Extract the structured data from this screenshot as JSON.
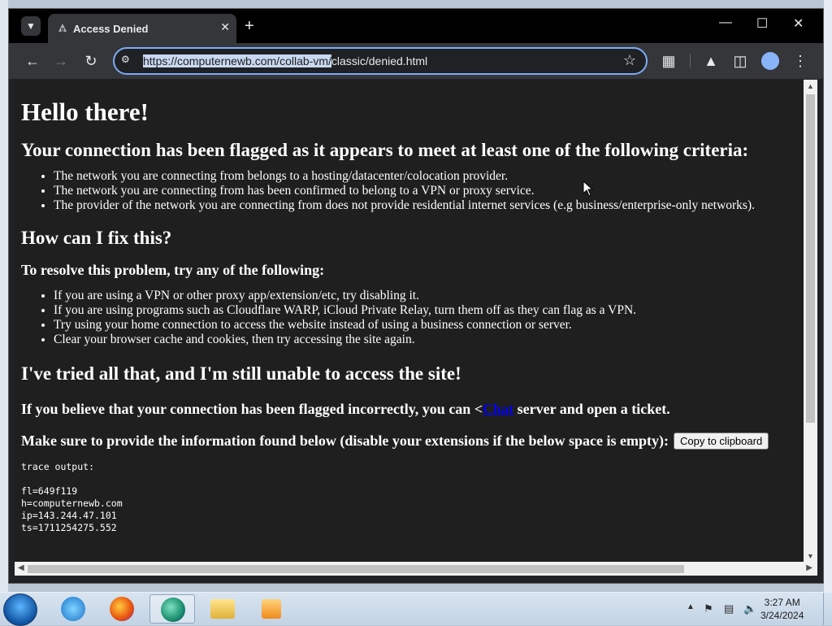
{
  "browser": {
    "tab_title": "Access Denied",
    "url_selected": "https://computernewb.com/collab-vm/",
    "url_rest": "classic/denied.html"
  },
  "page": {
    "h1": "Hello there!",
    "criteria_heading": "Your connection has been flagged as it appears to meet at least one of the following criteria:",
    "criteria": [
      "The network you are connecting from belongs to a hosting/datacenter/colocation provider.",
      "The network you are connecting from has been confirmed to belong to a VPN or proxy service.",
      "The provider of the network you are connecting from does not provide residential internet services (e.g business/enterprise-only networks)."
    ],
    "fix_heading": "How can I fix this?",
    "resolve_heading": "To resolve this problem, try any of the following:",
    "fixes": [
      "If you are using a VPN or other proxy app/extension/etc, try disabling it.",
      "If you are using programs such as Cloudflare WARP, iCloud Private Relay, turn them off as they can flag as a VPN.",
      "Try using your home connection to access the website instead of using a business connection or server.",
      "Clear your browser cache and cookies, then try accessing the site again."
    ],
    "tried_heading": "I've tried all that, and I'm still unable to access the site!",
    "flag_prefix": "If you believe that your connection has been flagged incorrectly, you can <",
    "flag_link": "Chat",
    "flag_suffix": " server and open a ticket.",
    "provide_text": "Make sure to provide the information found below (disable your extensions if the below space is empty):",
    "copy_button": "Copy to clipboard",
    "trace_label": "trace output:",
    "trace_lines": [
      "fl=649f119",
      "h=computernewb.com",
      "ip=143.244.47.101",
      "ts=1711254275.552"
    ]
  },
  "taskbar": {
    "time": "3:27 AM",
    "date": "3/24/2024"
  },
  "icons": [
    "tab-search-icon",
    "favicon-icon",
    "close-icon",
    "plus-icon",
    "minimize-icon",
    "maximize-icon",
    "back-icon",
    "forward-icon",
    "reload-icon",
    "site-info-icon",
    "star-icon",
    "extensions-icon",
    "labs-icon",
    "side-panel-icon",
    "profile-icon",
    "menu-icon",
    "start-icon",
    "ie-icon",
    "firefox-icon",
    "app-icon",
    "folder-icon",
    "media-icon",
    "flag-icon",
    "network-icon",
    "volume-icon",
    "cursor-icon"
  ],
  "colors": {
    "accent": "#7cacf8",
    "page_bg": "#1f1f1f",
    "link": "#0000ee"
  }
}
